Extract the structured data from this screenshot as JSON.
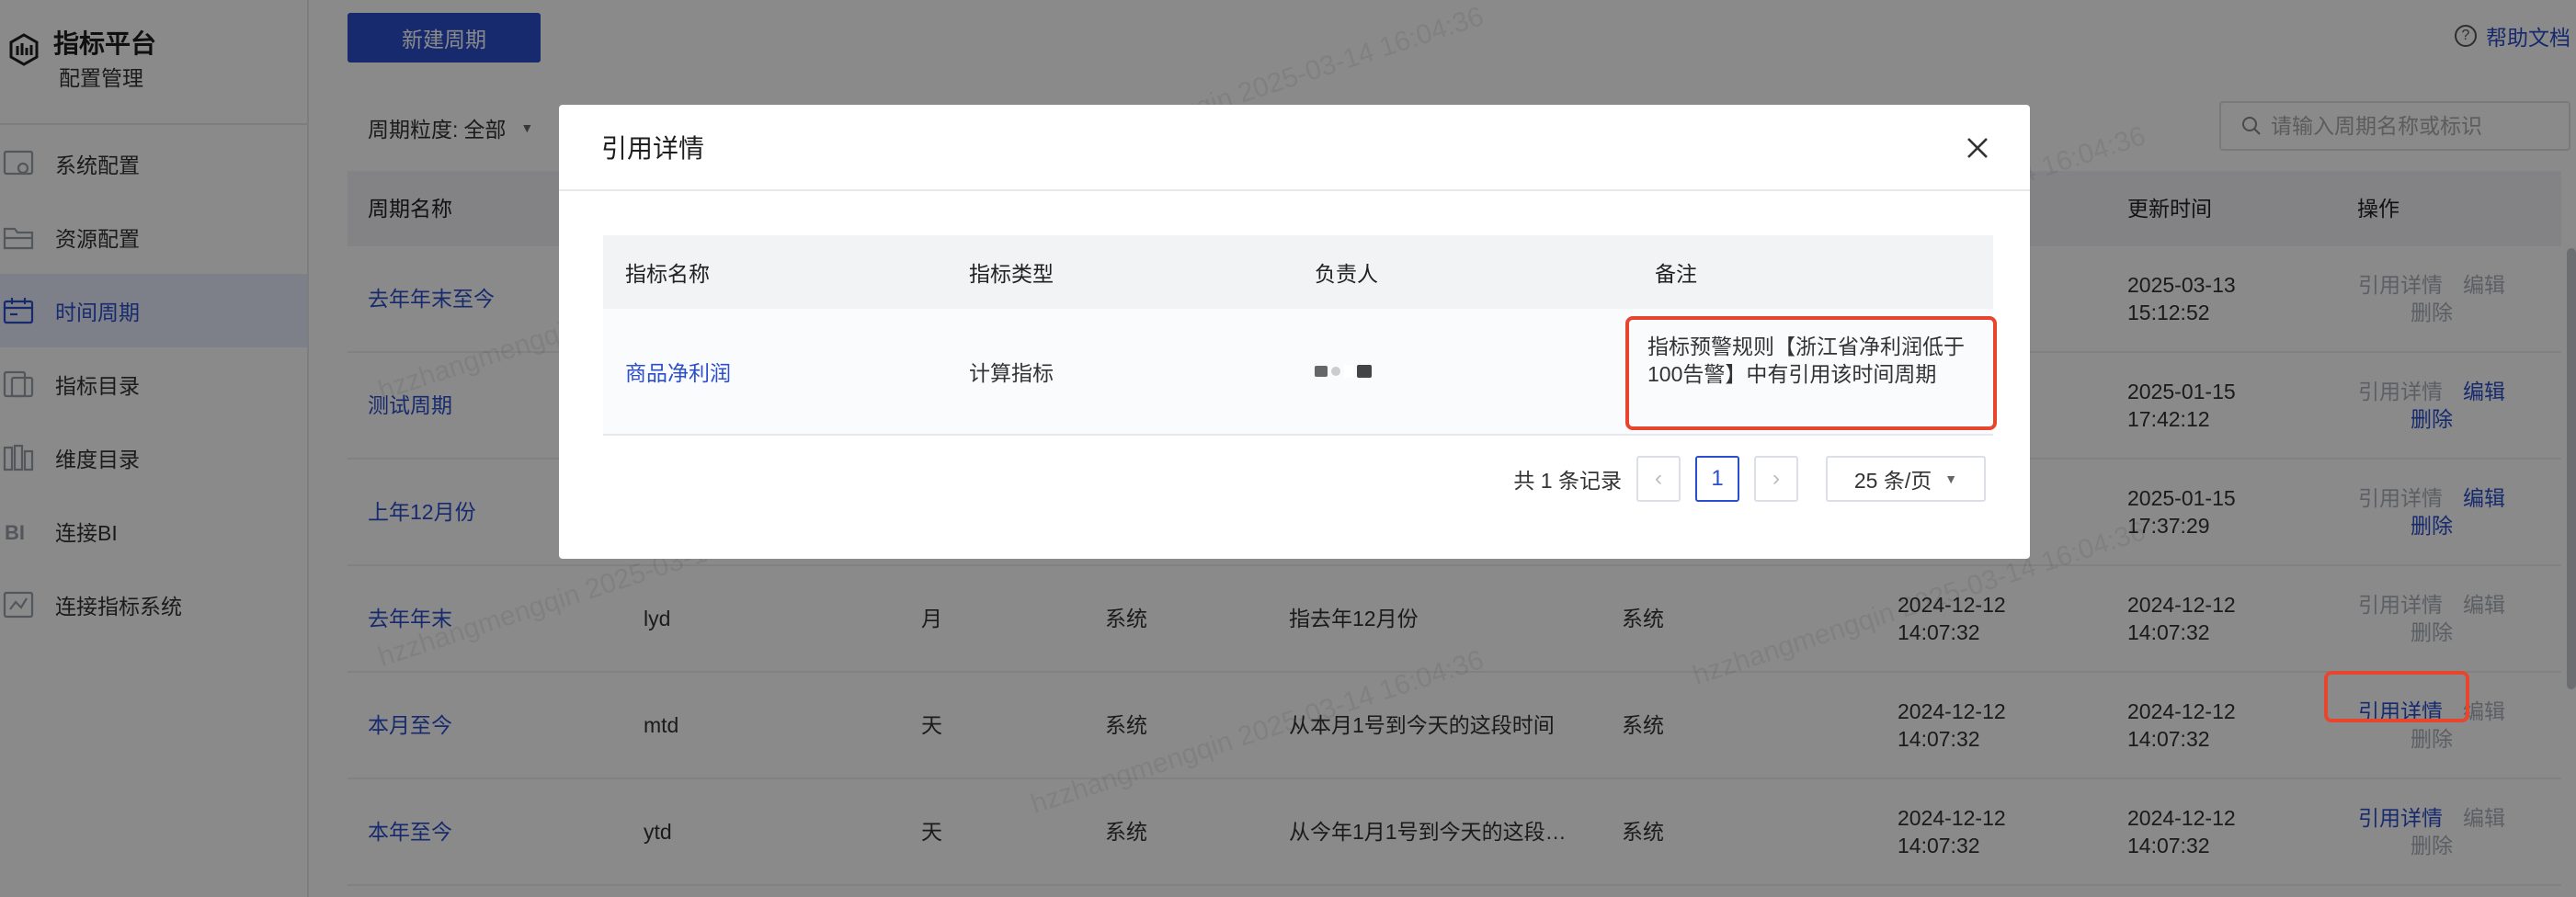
{
  "brand": {
    "title": "指标平台",
    "subtitle": "配置管理"
  },
  "sidebar": {
    "items": [
      {
        "label": "系统配置",
        "icon": "system-config-icon"
      },
      {
        "label": "资源配置",
        "icon": "folder-icon"
      },
      {
        "label": "时间周期",
        "icon": "calendar-icon",
        "active": true
      },
      {
        "label": "指标目录",
        "icon": "metric-catalog-icon"
      },
      {
        "label": "维度目录",
        "icon": "dimension-catalog-icon"
      },
      {
        "label": "连接BI",
        "icon": "bi-icon"
      },
      {
        "label": "连接指标系统",
        "icon": "connect-system-icon"
      }
    ]
  },
  "toolbar": {
    "new_button": "新建周期",
    "help": "帮助文档"
  },
  "filter": {
    "label": "周期粒度:",
    "value": "全部"
  },
  "search": {
    "placeholder": "请输入周期名称或标识"
  },
  "table": {
    "headers": {
      "name": "周期名称",
      "update": "更新时间",
      "ops": "操作"
    },
    "rows": [
      {
        "name": "去年年末至今",
        "update_date": "2025-03-13",
        "update_time": "15:12:52",
        "op1": "引用详情",
        "op1_enabled": false,
        "op2": "编辑",
        "op2_enabled": false,
        "op3": "删除",
        "op3_enabled": false
      },
      {
        "name": "测试周期",
        "update_date": "2025-01-15",
        "update_time": "17:42:12",
        "op1": "引用详情",
        "op1_enabled": false,
        "op2": "编辑",
        "op2_enabled": true,
        "op3": "删除",
        "op3_enabled": true
      },
      {
        "name": "上年12月份",
        "update_date": "2025-01-15",
        "update_time": "17:37:29",
        "op1": "引用详情",
        "op1_enabled": false,
        "op2": "编辑",
        "op2_enabled": true,
        "op3": "删除",
        "op3_enabled": true
      },
      {
        "name": "去年年末",
        "code": "lyd",
        "granularity": "月",
        "type": "系统",
        "desc": "指去年12月份",
        "creator": "系统",
        "create_date": "2024-12-12",
        "create_time": "14:07:32",
        "update_date": "2024-12-12",
        "update_time": "14:07:32",
        "op1": "引用详情",
        "op1_enabled": false,
        "op2": "编辑",
        "op2_enabled": false,
        "op3": "删除",
        "op3_enabled": false
      },
      {
        "name": "本月至今",
        "code": "mtd",
        "granularity": "天",
        "type": "系统",
        "desc": "从本月1号到今天的这段时间",
        "creator": "系统",
        "create_date": "2024-12-12",
        "create_time": "14:07:32",
        "update_date": "2024-12-12",
        "update_time": "14:07:32",
        "op1": "引用详情",
        "op1_enabled": true,
        "op2": "编辑",
        "op2_enabled": false,
        "op3": "删除",
        "op3_enabled": false
      },
      {
        "name": "本年至今",
        "code": "ytd",
        "granularity": "天",
        "type": "系统",
        "desc": "从今年1月1号到今天的这段…",
        "creator": "系统",
        "create_date": "2024-12-12",
        "create_time": "14:07:32",
        "update_date": "2024-12-12",
        "update_time": "14:07:32",
        "op1": "引用详情",
        "op1_enabled": true,
        "op2": "编辑",
        "op2_enabled": false,
        "op3": "删除",
        "op3_enabled": false
      }
    ]
  },
  "modal": {
    "title": "引用详情",
    "headers": {
      "name": "指标名称",
      "type": "指标类型",
      "owner": "负责人",
      "note": "备注"
    },
    "rows": [
      {
        "name": "商品净利润",
        "type": "计算指标",
        "note": "指标预警规则【浙江省净利润低于100告警】中有引用该时间周期"
      }
    ],
    "pager": {
      "total": "共 1 条记录",
      "current": "1",
      "page_size": "25 条/页"
    }
  },
  "watermark": "hzzhangmengqin 2025-03-14 16:04:36",
  "colors": {
    "accent": "#2b4fcc",
    "highlight": "#e8452f"
  }
}
